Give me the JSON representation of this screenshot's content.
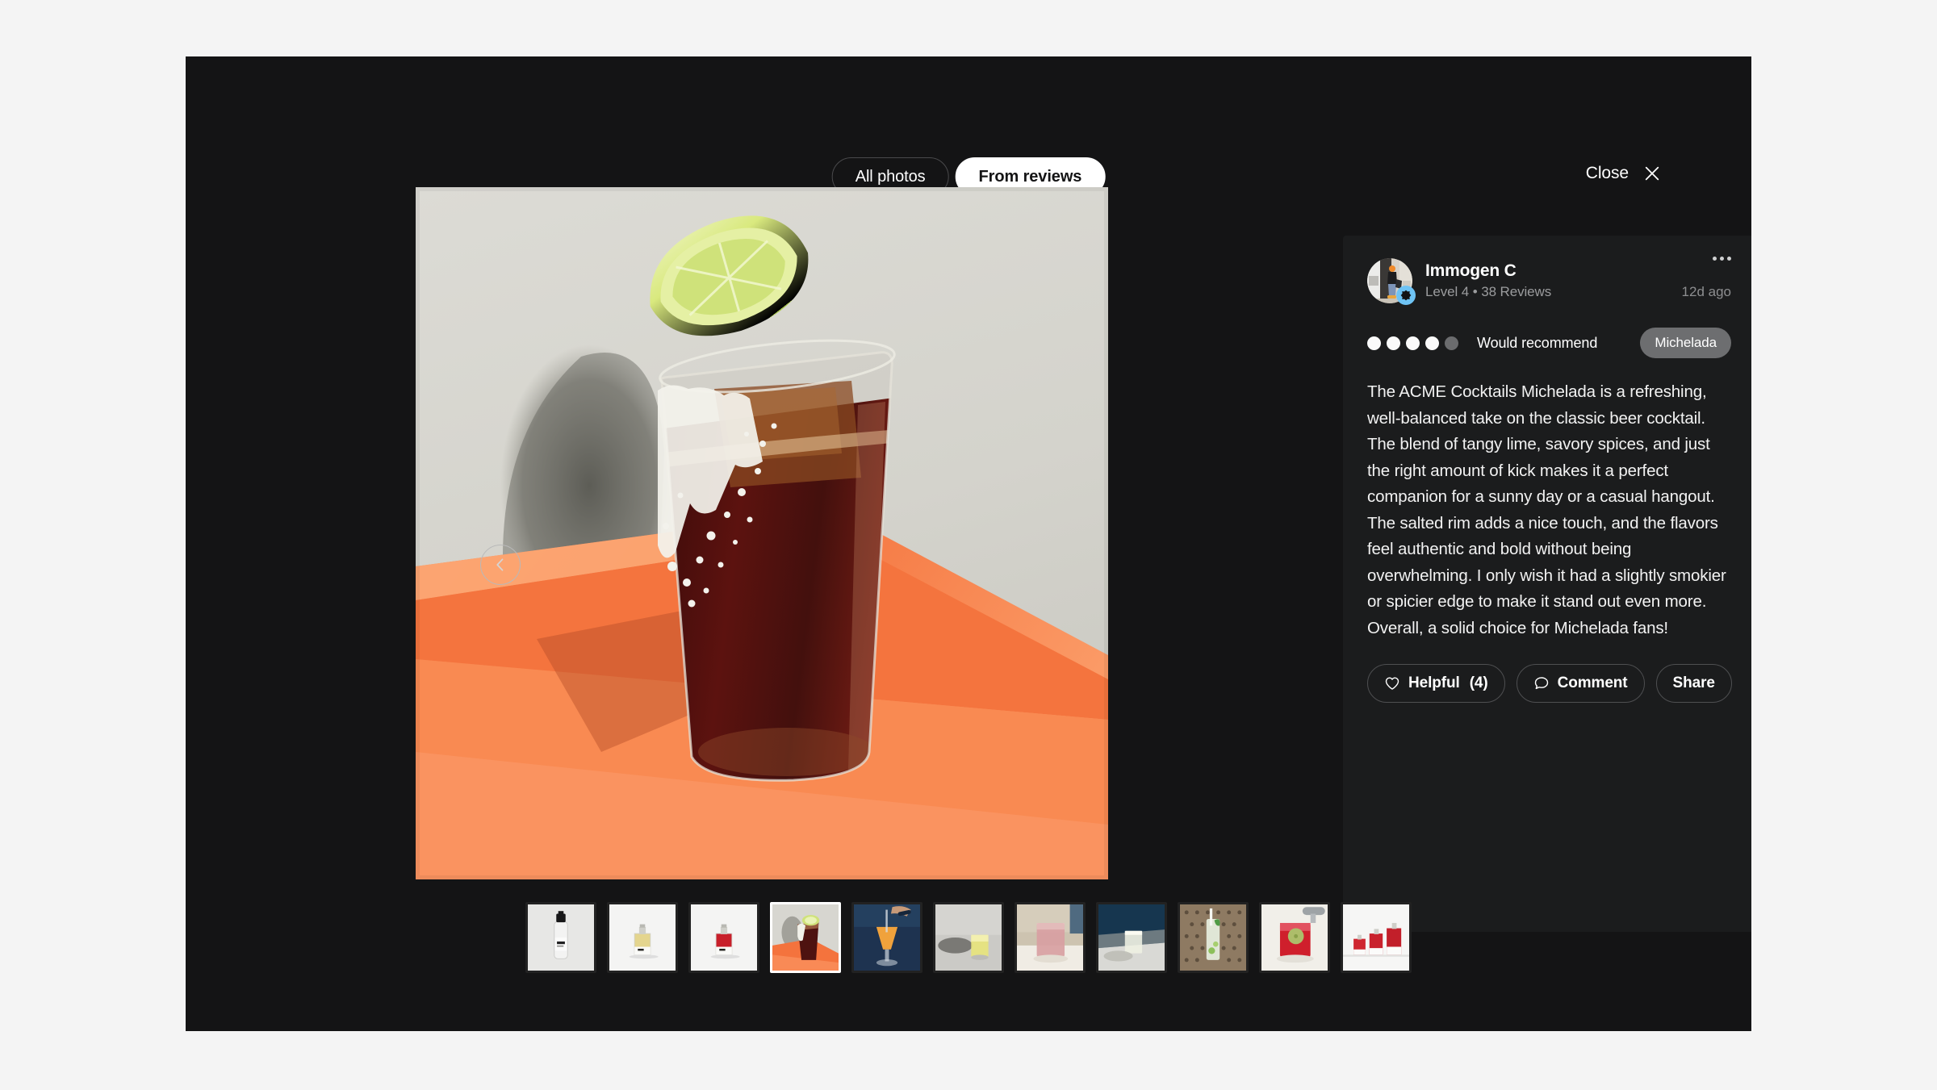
{
  "modal": {
    "tabs": [
      {
        "label": "All photos",
        "active": false
      },
      {
        "label": "From reviews",
        "active": true
      }
    ],
    "close": {
      "label": "Close",
      "icon": "close-x-icon"
    },
    "nav": {
      "prev_icon": "chevron-left-icon",
      "next_icon": "chevron-right-icon"
    }
  },
  "hero": {
    "alt": "Michelada cocktail in a salt-rimmed glass with a lime wedge on an orange ledge",
    "colors": {
      "wall": "#d6d5cf",
      "ledge": "#f2703a",
      "ledge_light": "#f98a52",
      "drink": "#4a0f0d",
      "lime": "#c8dd6a",
      "salt": "#efeee7"
    }
  },
  "review": {
    "author": "Immogen C",
    "meta": "Level 4  •  38 Reviews",
    "level_text": "Level 4",
    "reviews_text": "38 Reviews",
    "timestamp": "12d ago",
    "menu_icon": "more-horizontal-icon",
    "verified_badge_icon": "verified-badge-icon",
    "rating": {
      "value": 4,
      "max": 5
    },
    "recommend_label": "Would recommend",
    "product_tag": "Michelada",
    "text": "The ACME Cocktails Michelada is a refreshing, well-balanced take on the classic beer cocktail. The blend of tangy lime, savory spices, and just the right amount of kick makes it a perfect companion for a sunny day or a casual hangout. The salted rim adds a nice touch, and the flavors feel authentic and bold without being overwhelming. I only wish it had a slightly smokier or spicier edge to make it stand out even more. Overall, a solid choice for Michelada fans!",
    "actions": [
      {
        "label": "Helpful",
        "count": "(4)",
        "icon": "heart-icon"
      },
      {
        "label": "Comment",
        "count": "",
        "icon": "comment-bubble-icon"
      },
      {
        "label": "Share",
        "count": "",
        "icon": ""
      }
    ]
  },
  "thumbnails": [
    {
      "name": "acme-clear-bottle",
      "selected": false,
      "kind": "bottle-clear"
    },
    {
      "name": "acme-amber-flask",
      "selected": false,
      "kind": "flask-amber"
    },
    {
      "name": "acme-red-flask",
      "selected": false,
      "kind": "flask-red"
    },
    {
      "name": "michelada-orange-ledge",
      "selected": true,
      "kind": "michelada"
    },
    {
      "name": "orange-cocktail-stirred",
      "selected": false,
      "kind": "orange-coupe"
    },
    {
      "name": "yellow-drink-concrete",
      "selected": false,
      "kind": "yellow-rocks"
    },
    {
      "name": "pink-drink-table",
      "selected": false,
      "kind": "pink-tumbler"
    },
    {
      "name": "clear-drink-dockside",
      "selected": false,
      "kind": "dock-glass"
    },
    {
      "name": "mojito-mesh-table",
      "selected": false,
      "kind": "mojito"
    },
    {
      "name": "red-cocktail-napkin",
      "selected": false,
      "kind": "red-rocks"
    },
    {
      "name": "acme-bottle-trio",
      "selected": false,
      "kind": "trio"
    }
  ],
  "colors": {
    "page_background": "#f4f4f4",
    "modal_background": "#141415",
    "card_background": "#1b1c1d",
    "accent_white": "#ffffff",
    "muted_text": "#9b9c9e",
    "tag_background": "#6d6e70",
    "badge_blue": "#6ec3f4"
  }
}
